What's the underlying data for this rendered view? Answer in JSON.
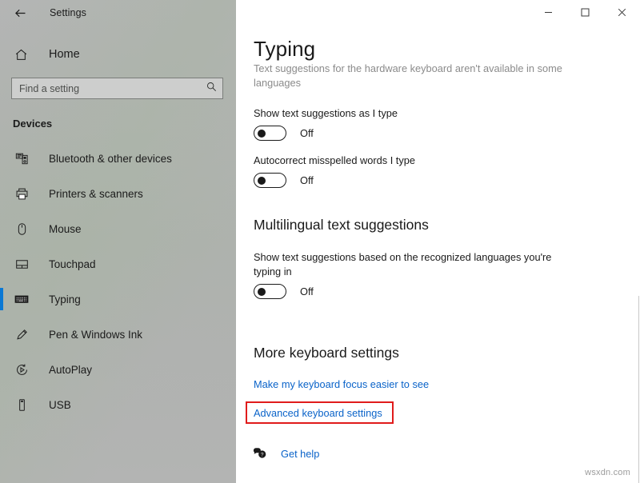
{
  "theme": {
    "accent": "#0a78d4",
    "highlight": "#e01b1b",
    "link": "#0a63c9"
  },
  "sidebar": {
    "back_icon": "back-arrow-icon",
    "app_title": "Settings",
    "home": {
      "label": "Home",
      "icon": "home-icon"
    },
    "search": {
      "value": "",
      "placeholder": "Find a setting",
      "icon": "search-icon"
    },
    "section_label": "Devices",
    "items": [
      {
        "label": "Bluetooth & other devices",
        "icon": "bluetooth-devices-icon",
        "selected": false
      },
      {
        "label": "Printers & scanners",
        "icon": "printer-icon",
        "selected": false
      },
      {
        "label": "Mouse",
        "icon": "mouse-icon",
        "selected": false
      },
      {
        "label": "Touchpad",
        "icon": "touchpad-icon",
        "selected": false
      },
      {
        "label": "Typing",
        "icon": "keyboard-icon",
        "selected": true
      },
      {
        "label": "Pen & Windows Ink",
        "icon": "pen-icon",
        "selected": false
      },
      {
        "label": "AutoPlay",
        "icon": "autoplay-icon",
        "selected": false
      },
      {
        "label": "USB",
        "icon": "usb-icon",
        "selected": false
      }
    ]
  },
  "window_controls": {
    "minimize": {
      "label": "—",
      "name": "minimize-button"
    },
    "maximize": {
      "label": "□",
      "name": "maximize-button"
    },
    "close": {
      "label": "✕",
      "name": "close-button"
    }
  },
  "main": {
    "page_title": "Typing",
    "clipped_note": "Text suggestions for the hardware keyboard aren't available in some languages",
    "settings": [
      {
        "label": "Show text suggestions as I type",
        "state": "Off",
        "on": false
      },
      {
        "label": "Autocorrect misspelled words I type",
        "state": "Off",
        "on": false
      }
    ],
    "multilingual": {
      "heading": "Multilingual text suggestions",
      "label": "Show text suggestions based on the recognized languages you're typing in",
      "state": "Off",
      "on": false
    },
    "more_keyboard": {
      "heading": "More keyboard settings",
      "links": [
        {
          "label": "Make my keyboard focus easier to see",
          "highlighted": false
        },
        {
          "label": "Advanced keyboard settings",
          "highlighted": true
        }
      ]
    },
    "get_help": {
      "label": "Get help",
      "icon": "help-bubble-icon"
    }
  },
  "watermark": "wsxdn.com"
}
